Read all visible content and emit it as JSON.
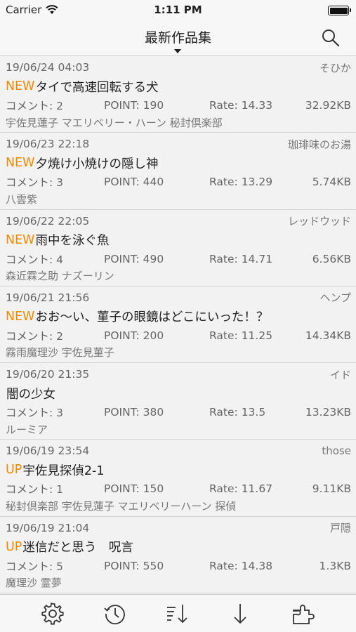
{
  "status": {
    "carrier": "Carrier",
    "time": "1:11 PM"
  },
  "nav": {
    "title": "最新作品集"
  },
  "items": [
    {
      "date": "19/06/24 04:03",
      "author": "そひか",
      "badge": "NEW",
      "title": "タイで高速回転する犬",
      "comments": "コメント: 2",
      "points": "POINT: 190",
      "rate": "Rate: 14.33",
      "size": "32.92KB",
      "tags": "宇佐見蓮子 マエリベリー・ハーン 秘封倶楽部"
    },
    {
      "date": "19/06/23 22:18",
      "author": "珈琲味のお湯",
      "badge": "NEW",
      "title": "夕焼け小焼けの隠し神",
      "comments": "コメント: 3",
      "points": "POINT: 440",
      "rate": "Rate: 13.29",
      "size": "5.74KB",
      "tags": "八雲紫"
    },
    {
      "date": "19/06/22 22:05",
      "author": "レッドウッド",
      "badge": "NEW",
      "title": "雨中を泳ぐ魚",
      "comments": "コメント: 4",
      "points": "POINT: 490",
      "rate": "Rate: 14.71",
      "size": "6.56KB",
      "tags": "森近霖之助 ナズーリン"
    },
    {
      "date": "19/06/21 21:56",
      "author": "ヘンプ",
      "badge": "NEW",
      "title": "おお〜い、菫子の眼鏡はどこにいった！？",
      "comments": "コメント: 2",
      "points": "POINT: 200",
      "rate": "Rate: 11.25",
      "size": "14.34KB",
      "tags": "霧雨魔理沙 宇佐見菫子"
    },
    {
      "date": "19/06/20 21:35",
      "author": "イド",
      "badge": "",
      "title": "闇の少女",
      "comments": "コメント: 3",
      "points": "POINT: 380",
      "rate": "Rate: 13.5",
      "size": "13.23KB",
      "tags": "ルーミア"
    },
    {
      "date": "19/06/19 23:54",
      "author": "those",
      "badge": "UP",
      "title": "宇佐見探偵2-1",
      "comments": "コメント: 1",
      "points": "POINT: 150",
      "rate": "Rate: 11.67",
      "size": "9.11KB",
      "tags": "秘封倶楽部 宇佐見蓮子 マエリベリーハーン 探偵"
    },
    {
      "date": "19/06/19 21:04",
      "author": "戸隠",
      "badge": "UP",
      "title": "迷信だと思う　呪言",
      "comments": "コメント: 5",
      "points": "POINT: 550",
      "rate": "Rate: 14.38",
      "size": "1.3KB",
      "tags": "魔理沙 霊夢"
    }
  ],
  "icons": {
    "search": "search-icon",
    "settings": "gear-icon",
    "history": "history-icon",
    "sort": "sort-icon",
    "download": "download-icon",
    "plugin": "puzzle-icon"
  },
  "colors": {
    "badge": "#f08a00"
  }
}
